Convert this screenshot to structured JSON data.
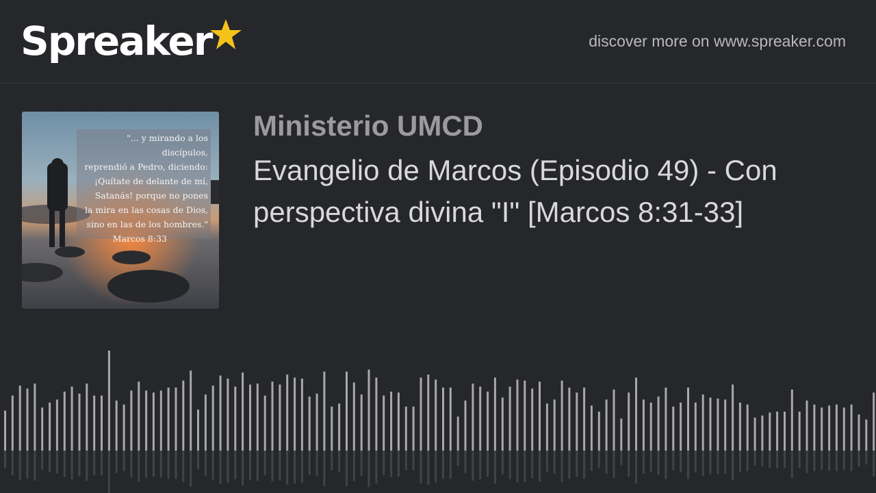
{
  "header": {
    "logo_text": "Spreaker",
    "logo_icon": "star-icon",
    "discover_text": "discover more on www.spreaker.com",
    "brand_star_color": "#f5c21b"
  },
  "cover": {
    "quote_lines": [
      "\"... y mirando a los discípulos,",
      "reprendió a Pedro, diciendo:",
      "¡Quítate de delante de mí,",
      "Satanás! porque no pones",
      "la mira en las cosas de Dios,",
      "sino en las de los hombres.\""
    ],
    "quote_ref": "Marcos 8:33"
  },
  "podcast": {
    "name": "Ministerio UMCD",
    "episode_title": "Evangelio de Marcos (Episodio 49) - Con perspectiva divina \"I\" [Marcos 8:31-33]"
  },
  "waveform": {
    "bar_color": "#a9a9ad",
    "levels": [
      0.4,
      0.55,
      0.65,
      0.62,
      0.67,
      0.43,
      0.48,
      0.51,
      0.59,
      0.64,
      0.57,
      0.67,
      0.55,
      0.55,
      1.0,
      0.5,
      0.46,
      0.6,
      0.69,
      0.6,
      0.58,
      0.6,
      0.63,
      0.63,
      0.7,
      0.8,
      0.41,
      0.56,
      0.65,
      0.75,
      0.72,
      0.64,
      0.78,
      0.66,
      0.67,
      0.55,
      0.69,
      0.66,
      0.76,
      0.73,
      0.72,
      0.54,
      0.57,
      0.79,
      0.44,
      0.47,
      0.79,
      0.68,
      0.56,
      0.81,
      0.73,
      0.55,
      0.59,
      0.58,
      0.44,
      0.44,
      0.73,
      0.76,
      0.71,
      0.63,
      0.63,
      0.34,
      0.5,
      0.67,
      0.64,
      0.59,
      0.73,
      0.53,
      0.64,
      0.71,
      0.7,
      0.62,
      0.69,
      0.47,
      0.51,
      0.7,
      0.63,
      0.58,
      0.63,
      0.45,
      0.39,
      0.51,
      0.61,
      0.32,
      0.58,
      0.73,
      0.51,
      0.48,
      0.54,
      0.63,
      0.44,
      0.48,
      0.63,
      0.48,
      0.56,
      0.53,
      0.52,
      0.51,
      0.66,
      0.48,
      0.46,
      0.33,
      0.35,
      0.38,
      0.39,
      0.39,
      0.61,
      0.39,
      0.5,
      0.46,
      0.43,
      0.45,
      0.46,
      0.43,
      0.46,
      0.36,
      0.31,
      0.58
    ]
  }
}
